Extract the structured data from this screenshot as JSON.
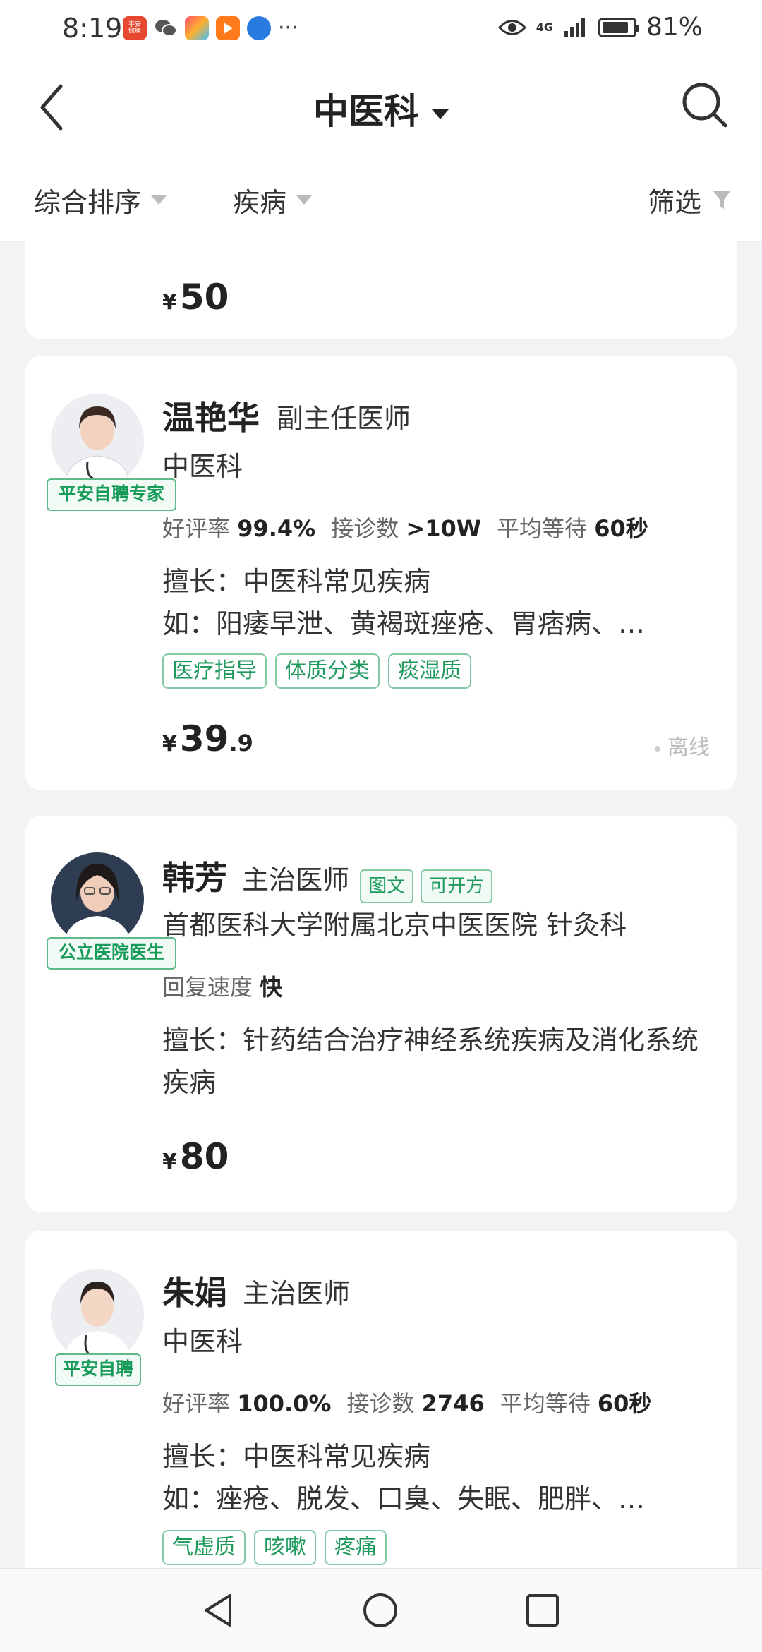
{
  "status_bar": {
    "time": "8:19",
    "app_icons": [
      {
        "name": "pingan-health-app-icon",
        "label": "平安\n健康",
        "color": "#e8472f"
      },
      {
        "name": "wechat-icon",
        "label": "",
        "color": "#555"
      },
      {
        "name": "app-grid-icon",
        "label": "",
        "color": "#ff6a3d"
      },
      {
        "name": "video-app-icon",
        "label": "",
        "color": "#ff7a1a"
      },
      {
        "name": "browser-icon",
        "label": "",
        "color": "#2a7be0"
      }
    ],
    "more": "···",
    "network": "4G",
    "battery": "81%"
  },
  "nav": {
    "title": "中医科"
  },
  "filters": {
    "sort": "综合排序",
    "disease": "疾病",
    "filter": "筛选"
  },
  "cards": [
    {
      "price": {
        "currency": "¥",
        "integer": "50",
        "decimal": ""
      }
    },
    {
      "name": "温艳华",
      "title": "副主任医师",
      "badge": "平安自聘专家",
      "dept": "中医科",
      "stats": {
        "rating_label": "好评率",
        "rating": "99.4%",
        "consult_label": "接诊数",
        "consult": ">10W",
        "wait_label": "平均等待",
        "wait": "60秒"
      },
      "skill_line1": "擅长：中医科常见疾病",
      "skill_line2": "如：阳痿早泄、黄褐斑痤疮、胃痞病、…",
      "tags": [
        "医疗指导",
        "体质分类",
        "痰湿质"
      ],
      "price": {
        "currency": "¥",
        "integer": "39",
        "decimal": ".9"
      },
      "status": "离线"
    },
    {
      "name": "韩芳",
      "title": "主治医师",
      "mini_tags": [
        "图文",
        "可开方"
      ],
      "badge": "公立医院医生",
      "dept": "首都医科大学附属北京中医医院  针灸科",
      "reply_label": "回复速度",
      "reply_value": "快",
      "skill": "擅长：针药结合治疗神经系统疾病及消化系统疾病",
      "price": {
        "currency": "¥",
        "integer": "80",
        "decimal": ""
      }
    },
    {
      "name": "朱娟",
      "title": "主治医师",
      "badge": "平安自聘",
      "dept": "中医科",
      "stats": {
        "rating_label": "好评率",
        "rating": "100.0%",
        "consult_label": "接诊数",
        "consult": "2746",
        "wait_label": "平均等待",
        "wait": "60秒"
      },
      "skill_line1": "擅长：中医科常见疾病",
      "skill_line2": "如：痤疮、脱发、口臭、失眠、肥胖、…",
      "tags": [
        "气虚质",
        "咳嗽",
        "疼痛"
      ]
    }
  ]
}
